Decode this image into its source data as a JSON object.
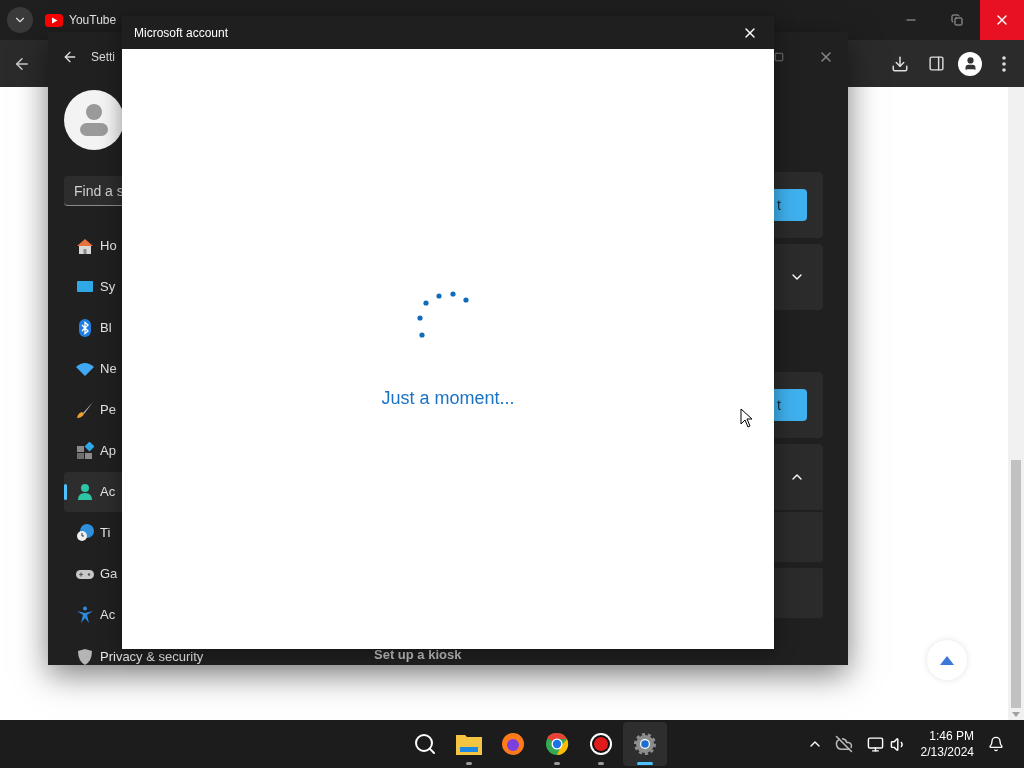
{
  "browser": {
    "tab_title": "YouTube"
  },
  "settings": {
    "title": "Setti",
    "search": {
      "placeholder": "Find a s"
    },
    "nav": [
      {
        "label": "Ho",
        "kind": "home",
        "selected": false
      },
      {
        "label": "Sy",
        "kind": "system",
        "selected": false
      },
      {
        "label": "Bl",
        "kind": "bluetooth",
        "selected": false
      },
      {
        "label": "Ne",
        "kind": "network",
        "selected": false
      },
      {
        "label": "Pe",
        "kind": "brush",
        "selected": false
      },
      {
        "label": "Ap",
        "kind": "apps",
        "selected": false
      },
      {
        "label": "Ac",
        "kind": "accounts",
        "selected": true
      },
      {
        "label": "Ti",
        "kind": "time",
        "selected": false
      },
      {
        "label": "Ga",
        "kind": "gaming",
        "selected": false
      },
      {
        "label": "Ac",
        "kind": "accessibility",
        "selected": false
      },
      {
        "label": "Privacy & security",
        "kind": "shield",
        "selected": false
      }
    ],
    "cards": [
      {
        "kind": "button",
        "label": "t"
      },
      {
        "kind": "expander",
        "expanded": false
      },
      {
        "kind": "button",
        "label": "t"
      },
      {
        "kind": "expander",
        "expanded": true
      },
      {
        "kind": "row"
      },
      {
        "kind": "row"
      }
    ],
    "footer_link": "Set up a kiosk"
  },
  "dialog": {
    "title": "Microsoft account",
    "message": "Just a moment..."
  },
  "taskbar": {
    "apps": [
      {
        "kind": "search",
        "running": false,
        "selected": false
      },
      {
        "kind": "folder",
        "running": true,
        "selected": false
      },
      {
        "kind": "firefox",
        "running": false,
        "selected": false
      },
      {
        "kind": "chrome",
        "running": true,
        "selected": false
      },
      {
        "kind": "recorder",
        "running": true,
        "selected": false
      },
      {
        "kind": "settings",
        "running": true,
        "selected": true
      }
    ],
    "time": "1:46 PM",
    "date": "2/13/2024"
  }
}
